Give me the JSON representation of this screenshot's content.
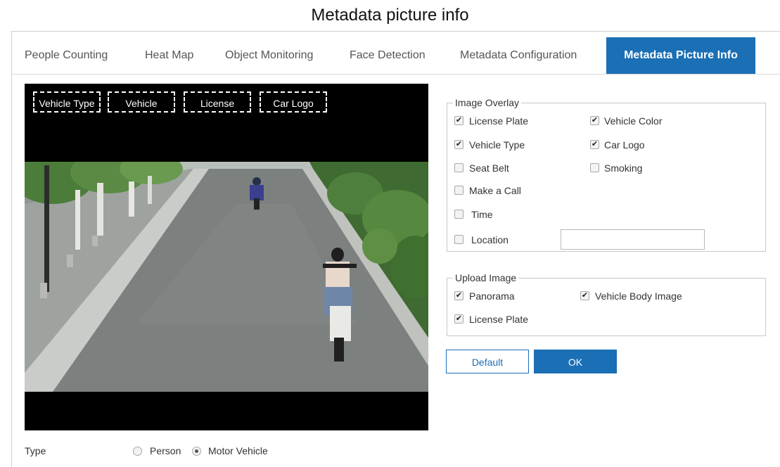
{
  "caption": "Metadata picture info",
  "tabs": [
    {
      "label": "People Counting"
    },
    {
      "label": "Heat Map"
    },
    {
      "label": "Object Monitoring"
    },
    {
      "label": "Face Detection"
    },
    {
      "label": "Metadata Configuration"
    },
    {
      "label": "Metadata Picture Info",
      "active": true
    }
  ],
  "preview": {
    "overlays": [
      "Vehicle Type",
      "Vehicle",
      "License",
      "Car Logo"
    ]
  },
  "image_overlay": {
    "legend": "Image Overlay",
    "items": [
      {
        "label": "License Plate",
        "checked": true
      },
      {
        "label": "Vehicle Color",
        "checked": true
      },
      {
        "label": "Vehicle Type",
        "checked": true
      },
      {
        "label": "Car Logo",
        "checked": true
      },
      {
        "label": "Seat Belt",
        "checked": false
      },
      {
        "label": "Smoking",
        "checked": false
      },
      {
        "label": "Make a Call",
        "checked": false
      },
      {
        "label": "Time",
        "checked": false
      },
      {
        "label": "Location",
        "checked": false
      }
    ],
    "location_value": ""
  },
  "upload_image": {
    "legend": "Upload Image",
    "items": [
      {
        "label": "Panorama",
        "checked": true
      },
      {
        "label": "Vehicle Body Image",
        "checked": true
      },
      {
        "label": "License Plate",
        "checked": true
      }
    ]
  },
  "buttons": {
    "default": "Default",
    "ok": "OK"
  },
  "type_row": {
    "label": "Type",
    "options": [
      {
        "label": "Person",
        "selected": false
      },
      {
        "label": "Motor Vehicle",
        "selected": true
      }
    ]
  },
  "colors": {
    "accent": "#1a6fb5"
  },
  "icons": {
    "checked": "check-mark-icon"
  }
}
